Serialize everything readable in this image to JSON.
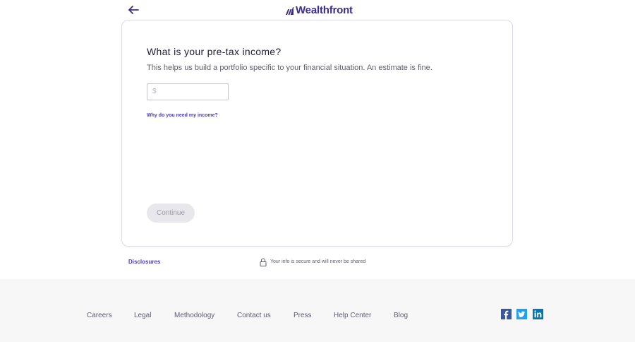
{
  "header": {
    "logo_text": "Wealthfront",
    "back_icon": "arrow-left-icon",
    "logo_icon": "wealthfront-mark-icon"
  },
  "card": {
    "question": "What is your pre-tax income?",
    "helper": "This helps us build a portfolio specific to your financial situation. An estimate is fine.",
    "income_prefix": "$",
    "income_value": "",
    "why_link": "Why do you need my income?",
    "continue_label": "Continue"
  },
  "below_card": {
    "disclosures": "Disclosures",
    "secure_text": "Your info is secure and will never be shared",
    "secure_icon": "lock-icon"
  },
  "footer": {
    "links": [
      "Careers",
      "Legal",
      "Methodology",
      "Contact us",
      "Press",
      "Help Center",
      "Blog"
    ],
    "social": [
      {
        "icon": "facebook-icon",
        "color": "#3b5998"
      },
      {
        "icon": "twitter-icon",
        "color": "#1da1f2"
      },
      {
        "icon": "linkedin-icon",
        "color": "#0077b5"
      }
    ]
  },
  "colors": {
    "brand": "#3c2a8f",
    "link": "#4a3cc6",
    "button_disabled_bg": "#e8e7ec",
    "button_disabled_text": "#9c9ba8",
    "footer_bg": "#f7f7f8"
  }
}
